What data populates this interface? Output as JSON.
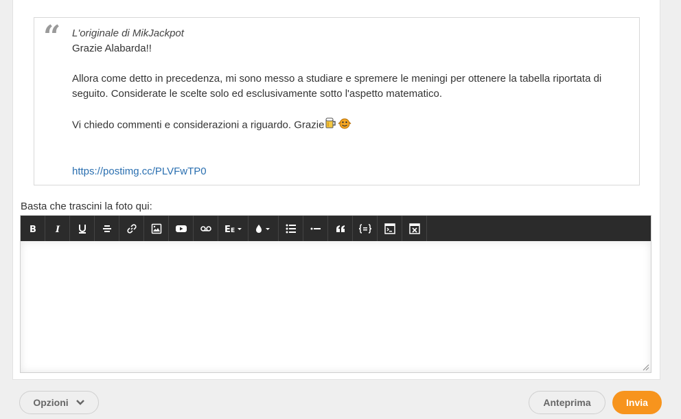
{
  "quote": {
    "author": "L'originale di MikJackpot",
    "line1": "Grazie Alabarda!!",
    "paragraph2": "Allora come detto in precedenza, mi sono messo a studiare e spremere le meningi per ottenere la tabella riportata di seguito. Considerate le scelte solo ed esclusivamente sotto l'aspetto matematico.",
    "paragraph3": "Vi chiedo commenti e considerazioni a riguardo. Grazie",
    "link": "https://postimg.cc/PLVFwTP0"
  },
  "editor": {
    "drop_label": "Basta che trascini la foto qui:",
    "toolbar": [
      "bold-icon",
      "italic-icon",
      "underline-icon",
      "strikethrough-icon",
      "link-icon",
      "image-icon",
      "youtube-icon",
      "voicemail-icon",
      "font-size-icon",
      "color-drop-icon",
      "bullet-list-icon",
      "horizontal-rule-icon",
      "quote-icon",
      "code-icon",
      "spoiler-icon",
      "remove-format-icon"
    ]
  },
  "footer": {
    "options_label": "Opzioni",
    "preview_label": "Anteprima",
    "send_label": "Invia"
  },
  "colors": {
    "accent": "#f7941d",
    "toolbar_bg": "#2b2b2b",
    "link": "#2a6fb0"
  }
}
